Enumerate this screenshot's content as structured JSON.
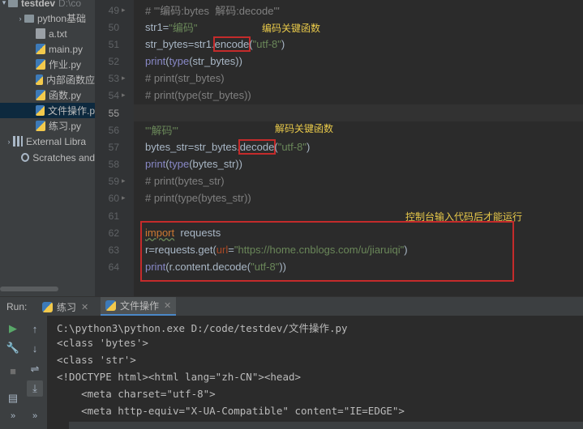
{
  "project": {
    "root_name": "testdev",
    "root_path": "D:\\co",
    "items": [
      {
        "label": "python基础",
        "type": "folder"
      },
      {
        "label": "a.txt",
        "type": "txt"
      },
      {
        "label": "main.py",
        "type": "py"
      },
      {
        "label": "作业.py",
        "type": "py"
      },
      {
        "label": "内部函数应",
        "type": "py"
      },
      {
        "label": "函数.py",
        "type": "py"
      },
      {
        "label": "文件操作.p",
        "type": "py",
        "selected": true
      },
      {
        "label": "练习.py",
        "type": "py"
      }
    ],
    "external_libraries": "External Libra",
    "scratches": "Scratches and"
  },
  "editor": {
    "lines": [
      {
        "num": "49",
        "text": "# '''编码:bytes  解码:decode'''"
      },
      {
        "num": "50",
        "text": "str1=\"编码\""
      },
      {
        "num": "51",
        "text": "str_bytes=str1.encode(\"utf-8\")"
      },
      {
        "num": "52",
        "text": "print(type(str_bytes))"
      },
      {
        "num": "53",
        "text": "# print(str_bytes)"
      },
      {
        "num": "54",
        "text": "# print(type(str_bytes))"
      },
      {
        "num": "55",
        "text": ""
      },
      {
        "num": "56",
        "text": "'''解码'''"
      },
      {
        "num": "57",
        "text": "bytes_str=str_bytes.decode(\"utf-8\")"
      },
      {
        "num": "58",
        "text": "print(type(bytes_str))"
      },
      {
        "num": "59",
        "text": "# print(bytes_str)"
      },
      {
        "num": "60",
        "text": "# print(type(bytes_str))"
      },
      {
        "num": "61",
        "text": ""
      },
      {
        "num": "62",
        "text": "import  requests"
      },
      {
        "num": "63",
        "text": "r=requests.get(url=\"https://home.cnblogs.com/u/jiaruiqi\")"
      },
      {
        "num": "64",
        "text": "print(r.content.decode(\"utf-8\"))"
      }
    ],
    "annotations": {
      "encode_note": "编码关键函数",
      "decode_note": "解码关键函数",
      "console_note": "控制台输入代码后才能运行"
    }
  },
  "run": {
    "label": "Run:",
    "tabs": [
      {
        "label": "练习",
        "active": false
      },
      {
        "label": "文件操作",
        "active": true
      }
    ],
    "console": [
      "C:\\python3\\python.exe D:/code/testdev/文件操作.py",
      "<class 'bytes'>",
      "<class 'str'>",
      "<!DOCTYPE html><html lang=\"zh-CN\"><head>",
      "    <meta charset=\"utf-8\">",
      "    <meta http-equiv=\"X-UA-Compatible\" content=\"IE=EDGE\">"
    ]
  },
  "colors": {
    "accent": "#4a88c7",
    "highlight_box": "#c42b2b",
    "annotation_text": "#e8c94a"
  }
}
